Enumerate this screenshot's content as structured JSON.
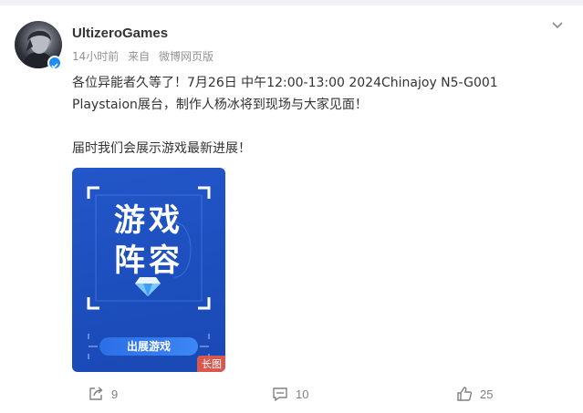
{
  "post": {
    "username": "UltizeroGames",
    "time": "14小时前",
    "source_prefix": "来自",
    "source": "微博网页版",
    "lines": [
      "各位异能者久等了！7月26日 中午12:00-13:00 2024Chinajoy N5-G001",
      "Playstaion展台，制作人杨冰将到现场与大家见面！",
      "届时我们会展示游戏最新进展！"
    ]
  },
  "image": {
    "title_line1": "游戏",
    "title_line2": "阵容",
    "banner": "出展游戏",
    "tag": "长图"
  },
  "actions": {
    "repost_count": "9",
    "comment_count": "10",
    "like_count": "25"
  },
  "colors": {
    "accent_blue": "#1e8cf0",
    "image_blue": "#2356c9",
    "tag_red": "#e65a46"
  },
  "icons": {
    "menu": "chevron-down-icon",
    "verified": "verified-badge-icon",
    "repost": "repost-icon",
    "comment": "comment-icon",
    "like": "thumbs-up-icon"
  }
}
